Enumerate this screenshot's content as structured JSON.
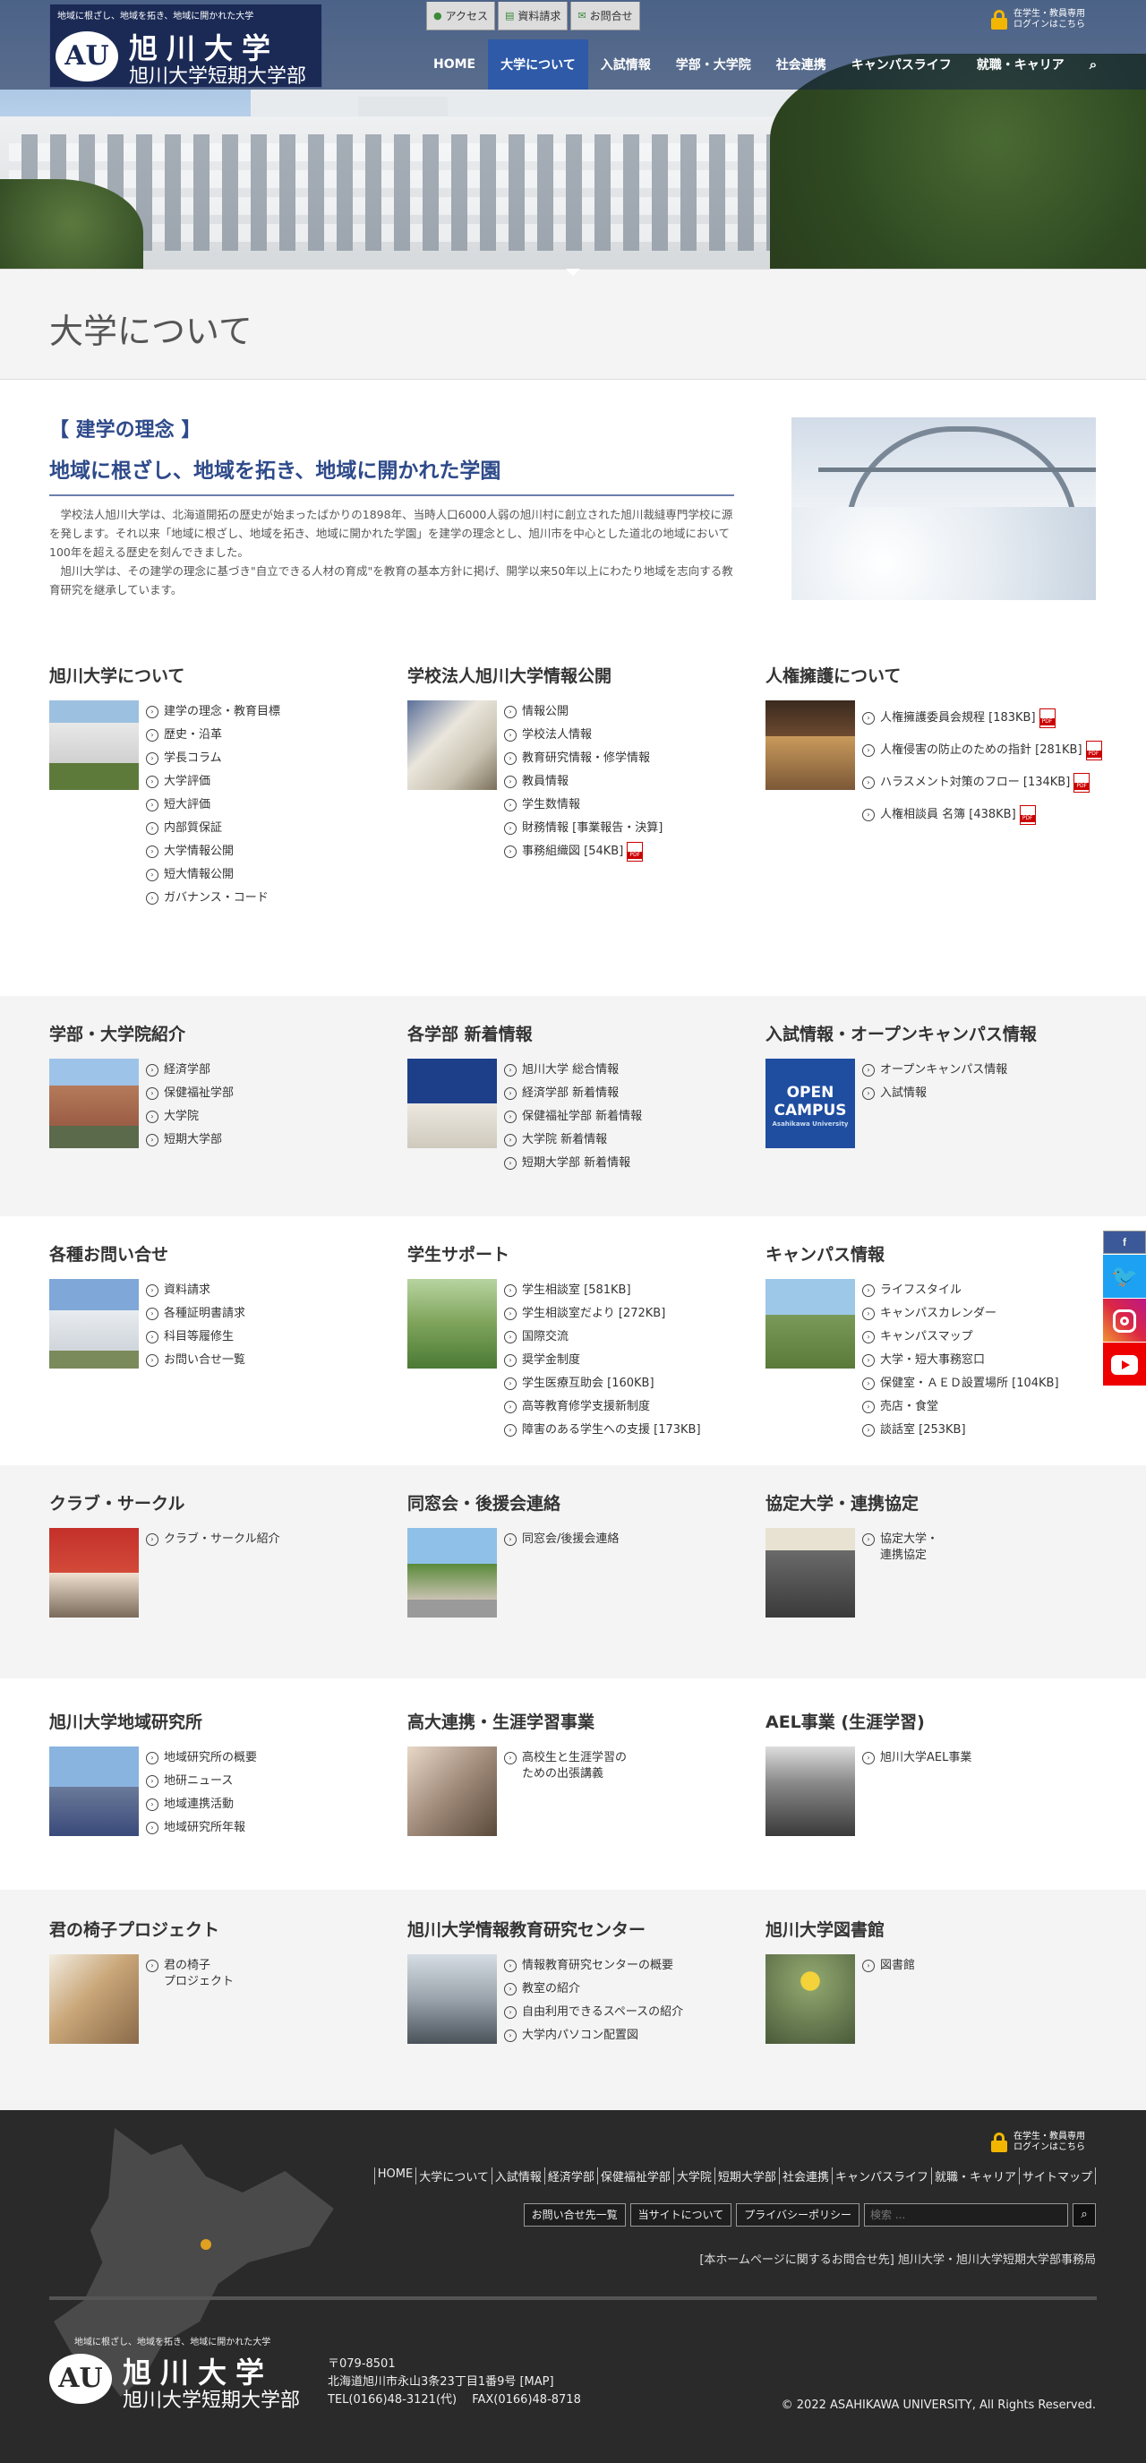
{
  "header": {
    "tagline": "地域に根ざし、地域を拓き、地域に開かれた大学",
    "logo_mark": "AU",
    "name1": "旭川大学",
    "name2": "旭川大学短期大学部",
    "top_links": [
      "アクセス",
      "資料請求",
      "お問合せ"
    ],
    "login": "在学生・教員専用\nログインはこちら",
    "menu": [
      "HOME",
      "大学について",
      "入試情報",
      "学部・大学院",
      "社会連携",
      "キャンパスライフ",
      "就職・キャリア"
    ],
    "search_icon": "⌕"
  },
  "page_title": "大学について",
  "philosophy": {
    "bracket": "【 建学の理念 】",
    "motto": "地域に根ざし、地域を拓き、地域に開かれた学園",
    "p1": "学校法人旭川大学は、北海道開拓の歴史が始まったばかりの1898年、当時人口6000人弱の旭川村に創立された旭川裁縫専門学校に源を発します。それ以来「地域に根ざし、地域を拓き、地域に開かれた学園」を建学の理念とし、旭川市を中心とした道北の地域において100年を超える歴史を刻んできました。",
    "p2": "旭川大学は、その建学の理念に基づき\"自立できる人材の育成\"を教育の基本方針に掲げ、開学以来50年以上にわたり地域を志向する教育研究を継承しています。"
  },
  "sections": [
    {
      "title": "旭川大学について",
      "items": [
        "建学の理念・教育目標",
        "歴史・沿革",
        "学長コラム",
        "大学評価",
        "短大評価",
        "内部質保証",
        "大学情報公開",
        "短大情報公開",
        "ガバナンス・コード"
      ]
    },
    {
      "title": "学校法人旭川大学情報公開",
      "items": [
        "情報公開",
        "学校法人情報",
        "教育研究情報・修学情報",
        "教員情報",
        "学生数情報",
        "財務情報 [事業報告・決算]",
        "事務組織図 [54KB]"
      ]
    },
    {
      "title": "人権擁護について",
      "items": [
        "人権擁護委員会規程 [183KB]",
        "人権侵害の防止のための指針 [281KB]",
        "ハラスメント対策のフロー [134KB]",
        "人権相談員 名簿 [438KB]"
      ]
    },
    {
      "title": "学部・大学院紹介",
      "items": [
        "経済学部",
        "保健福祉学部",
        "大学院",
        "短期大学部"
      ]
    },
    {
      "title": "各学部 新着情報",
      "items": [
        "旭川大学 総合情報",
        "経済学部 新着情報",
        "保健福祉学部 新着情報",
        "大学院 新着情報",
        "短期大学部 新着情報"
      ]
    },
    {
      "title": "入試情報・オープンキャンパス情報",
      "items": [
        "オープンキャンパス情報",
        "入試情報"
      ],
      "thumb_text": "OPEN CAMPUS",
      "thumb_sub": "Asahikawa University"
    },
    {
      "title": "各種お問い合せ",
      "items": [
        "資料請求",
        "各種証明書請求",
        "科目等履修生",
        "お問い合せ一覧"
      ]
    },
    {
      "title": "学生サポート",
      "items": [
        "学生相談室 [581KB]",
        "学生相談室だより [272KB]",
        "国際交流",
        "奨学金制度",
        "学生医療互助会 [160KB]",
        "高等教育修学支援新制度",
        "障害のある学生への支援 [173KB]"
      ]
    },
    {
      "title": "キャンパス情報",
      "items": [
        "ライフスタイル",
        "キャンパスカレンダー",
        "キャンパスマップ",
        "大学・短大事務窓口",
        "保健室・ＡＥＤ設置場所 [104KB]",
        "売店・食堂",
        "談話室 [253KB]"
      ]
    },
    {
      "title": "クラブ・サークル",
      "items": [
        "クラブ・サークル紹介"
      ]
    },
    {
      "title": "同窓会・後援会連絡",
      "items": [
        "同窓会/後援会連絡"
      ]
    },
    {
      "title": "協定大学・連携協定",
      "items": [
        "協定大学・\n連携協定"
      ]
    },
    {
      "title": "旭川大学地域研究所",
      "items": [
        "地域研究所の概要",
        "地研ニュース",
        "地域連携活動",
        "地域研究所年報"
      ]
    },
    {
      "title": "高大連携・生涯学習事業",
      "items": [
        "高校生と生涯学習の\nための出張講義"
      ]
    },
    {
      "title": "AEL事業 (生涯学習)",
      "items": [
        "旭川大学AEL事業"
      ]
    },
    {
      "title": "君の椅子プロジェクト",
      "items": [
        "君の椅子\nプロジェクト"
      ]
    },
    {
      "title": "旭川大学情報教育研究センター",
      "items": [
        "情報教育研究センターの概要",
        "教室の紹介",
        "自由利用できるスペースの紹介",
        "大学内パソコン配置図"
      ]
    },
    {
      "title": "旭川大学図書館",
      "items": [
        "図書館"
      ]
    }
  ],
  "social": {
    "facebook": "f",
    "twitter": "🐦"
  },
  "footer": {
    "login": "在学生・教員専用\nログインはこちら",
    "nav": [
      "HOME",
      "大学について",
      "入試情報",
      "経済学部",
      "保健福祉学部",
      "大学院",
      "短期大学部",
      "社会連携",
      "キャンパスライフ",
      "就職・キャリア",
      "サイトマップ"
    ],
    "buttons": [
      "お問い合せ先一覧",
      "当サイトについて",
      "プライバシーポリシー"
    ],
    "search_placeholder": "検索 ...",
    "search_icon": "⌕",
    "contact": "[本ホームページに関するお問合せ先] 旭川大学・旭川大学短期大学部事務局",
    "tagline": "地域に根ざし、地域を拓き、地域に開かれた大学",
    "logo_mark": "AU",
    "name1": "旭川大学",
    "name2": "旭川大学短期大学部",
    "zip": "〒079-8501",
    "address": "北海道旭川市永山3条23丁目1番9号 [MAP]",
    "tel": "TEL(0166)48-3121(代)　 FAX(0166)48-8718",
    "copyright": "© 2022 ASAHIKAWA UNIVERSITY, All Rights Reserved."
  }
}
